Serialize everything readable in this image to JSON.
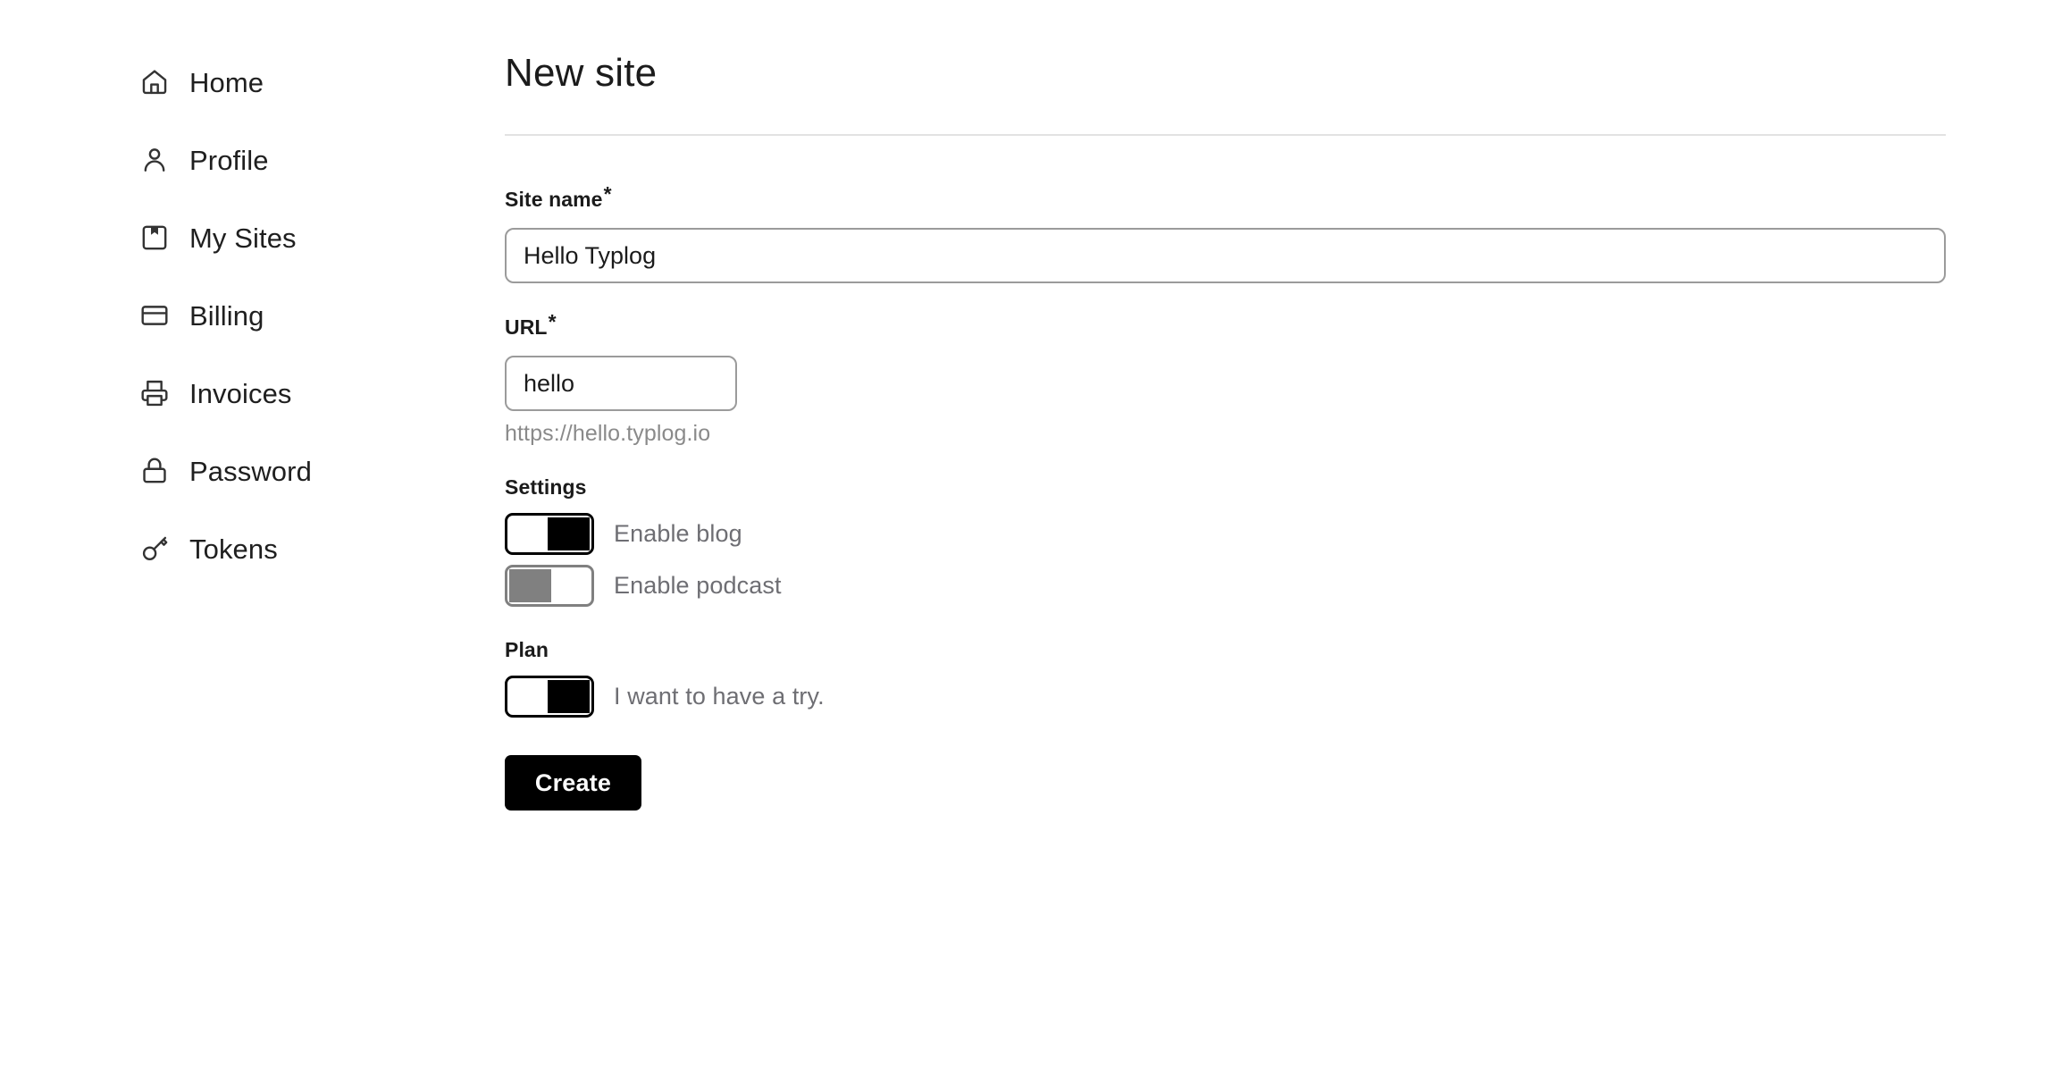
{
  "sidebar": {
    "items": [
      {
        "label": "Home",
        "icon": "home-icon"
      },
      {
        "label": "Profile",
        "icon": "person-icon"
      },
      {
        "label": "My Sites",
        "icon": "bookmark-box-icon"
      },
      {
        "label": "Billing",
        "icon": "credit-card-icon"
      },
      {
        "label": "Invoices",
        "icon": "printer-icon"
      },
      {
        "label": "Password",
        "icon": "lock-icon"
      },
      {
        "label": "Tokens",
        "icon": "key-icon"
      }
    ]
  },
  "main": {
    "title": "New site",
    "site_name": {
      "label": "Site name",
      "required_marker": "*",
      "value": "Hello Typlog",
      "placeholder": ""
    },
    "url": {
      "label": "URL",
      "required_marker": "*",
      "value": "hello",
      "placeholder": "",
      "hint": "https://hello.typlog.io"
    },
    "settings": {
      "heading": "Settings",
      "toggles": [
        {
          "label": "Enable blog",
          "state": "on"
        },
        {
          "label": "Enable podcast",
          "state": "off"
        }
      ]
    },
    "plan": {
      "heading": "Plan",
      "toggles": [
        {
          "label": "I want to have a try.",
          "state": "on"
        }
      ]
    },
    "submit": {
      "label": "Create"
    }
  },
  "colors": {
    "accent": "#000000",
    "text": "#1b1b1b",
    "muted_text": "#6e6e73",
    "hint_text": "#8a8a8a",
    "input_border": "#9b9b9b",
    "toggle_off": "#808080",
    "divider": "#e2e2e2",
    "background": "#ffffff"
  }
}
